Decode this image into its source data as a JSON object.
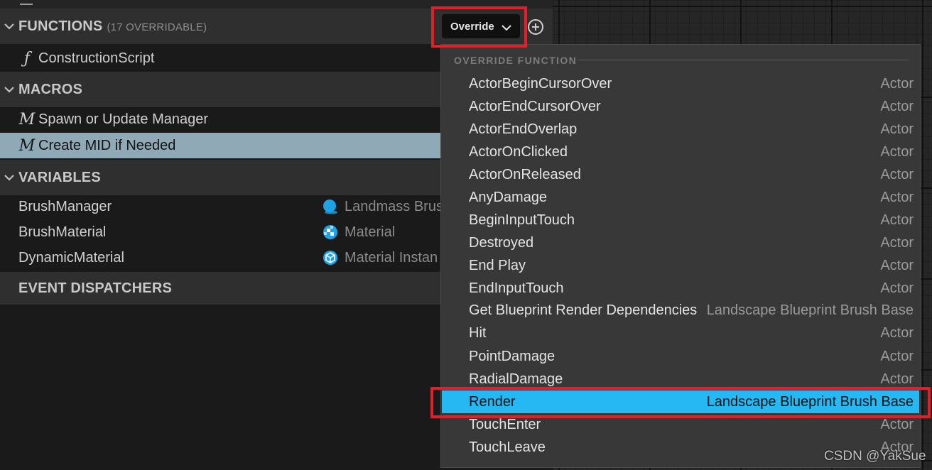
{
  "sections": {
    "functions": {
      "label": "FUNCTIONS",
      "count": "(17 OVERRIDABLE)"
    },
    "macros": {
      "label": "MACROS"
    },
    "variables": {
      "label": "VARIABLES"
    },
    "event_dispatchers": {
      "label": "EVENT DISPATCHERS"
    }
  },
  "functions": [
    {
      "label": "ConstructionScript",
      "icon": "function-icon"
    }
  ],
  "macros": [
    {
      "label": "Spawn or Update Manager",
      "icon": "macro-icon"
    },
    {
      "label": "Create MID if Needed",
      "icon": "macro-icon",
      "selected": true
    }
  ],
  "variables": [
    {
      "name": "BrushManager",
      "type": "Landmass Brus",
      "icon": "object-reference-icon",
      "color": "#1fa3e6"
    },
    {
      "name": "BrushMaterial",
      "type": "Material",
      "icon": "material-icon",
      "color": "#1fa3e6"
    },
    {
      "name": "DynamicMaterial",
      "type": "Material Instan",
      "icon": "material-instance-icon",
      "color": "#1fa3e6"
    }
  ],
  "toolbar": {
    "override_label": "Override"
  },
  "override_menu": {
    "title": "OVERRIDE FUNCTION",
    "items": [
      {
        "label": "ActorBeginCursorOver",
        "owner": "Actor"
      },
      {
        "label": "ActorEndCursorOver",
        "owner": "Actor"
      },
      {
        "label": "ActorEndOverlap",
        "owner": "Actor"
      },
      {
        "label": "ActorOnClicked",
        "owner": "Actor"
      },
      {
        "label": "ActorOnReleased",
        "owner": "Actor"
      },
      {
        "label": "AnyDamage",
        "owner": "Actor"
      },
      {
        "label": "BeginInputTouch",
        "owner": "Actor"
      },
      {
        "label": "Destroyed",
        "owner": "Actor"
      },
      {
        "label": "End Play",
        "owner": "Actor"
      },
      {
        "label": "EndInputTouch",
        "owner": "Actor"
      },
      {
        "label": "Get Blueprint Render Dependencies",
        "owner": "Landscape Blueprint Brush Base"
      },
      {
        "label": "Hit",
        "owner": "Actor"
      },
      {
        "label": "PointDamage",
        "owner": "Actor"
      },
      {
        "label": "RadialDamage",
        "owner": "Actor"
      },
      {
        "label": "Render",
        "owner": "Landscape Blueprint Brush Base",
        "active": true
      },
      {
        "label": "TouchEnter",
        "owner": "Actor"
      },
      {
        "label": "TouchLeave",
        "owner": "Actor"
      }
    ]
  },
  "colors": {
    "accent": "#26b8f2",
    "highlight": "#e0202a",
    "selected_row": "#8faab6"
  },
  "watermark": "CSDN @YakSue"
}
